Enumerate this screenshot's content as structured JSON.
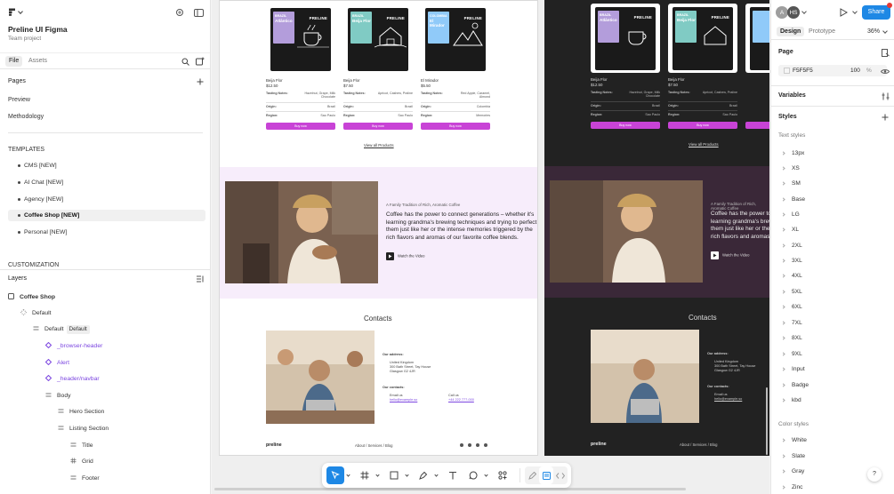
{
  "left_panel": {
    "project_name": "Preline UI Figma",
    "team": "Team project",
    "tabs": {
      "file": "File",
      "assets": "Assets"
    },
    "pages_title": "Pages",
    "pages": [
      "Preview",
      "Methodology"
    ],
    "templates_title": "TEMPLATES",
    "templates": [
      "CMS [NEW]",
      "AI Chat [NEW]",
      "Agency [NEW]",
      "Coffee Shop [NEW]",
      "Personal [NEW]"
    ],
    "customization_title": "CUSTOMIZATION",
    "layers_title": "Layers",
    "layers": {
      "root": "Coffee Shop",
      "default_frame": "Default",
      "default_variant": "Default",
      "default_tag": "Default",
      "browser_header": "_browser-header",
      "alert": "Alert",
      "header_navbar": "_header/navbar",
      "body": "Body",
      "hero": "Hero Section",
      "listing": "Listing Section",
      "title": "Title",
      "grid": "Grid",
      "footer": "Footer"
    }
  },
  "canvas": {
    "products": [
      {
        "brand": "PRELINE",
        "label_small": "BRAZIL",
        "label_title": "Atlântico",
        "label_color": "#b39ddb",
        "name": "Beija Flor",
        "price": "$12.50",
        "notes_key": "Tasting Notes:",
        "notes": "Hazelnut, Grape, Milk Chocolate",
        "origin_key": "Origin:",
        "origin": "Brazil",
        "region_key": "Region:",
        "region": "Sao Paulo",
        "buy": "Buy now"
      },
      {
        "brand": "PRELINE",
        "label_small": "BRAZIL",
        "label_title": "Beija Flor",
        "label_color": "#80cbc4",
        "name": "Beija Flor",
        "price": "$7.50",
        "notes_key": "Tasting Notes:",
        "notes": "Apricot, Cashew, Praline",
        "origin_key": "Origin:",
        "origin": "Brazil",
        "region_key": "Region:",
        "region": "Sao Paulo",
        "buy": "Buy now"
      },
      {
        "brand": "PRELINE",
        "label_small": "COLOMBIA",
        "label_title": "El Mirador",
        "label_color": "#90caf9",
        "name": "El Mirador",
        "price": "$5.50",
        "notes_key": "Tasting Notes:",
        "notes": "Red Apple, Caramel, Almond",
        "origin_key": "Origin:",
        "origin": "Colombia",
        "region_key": "Region:",
        "region": "Memories",
        "buy": "Buy now"
      }
    ],
    "view_all": "View all Products",
    "story_kicker": "A Family Tradition of Rich, Aromatic Coffee",
    "story_text": "Coffee has the power to connect generations – whether it's learning grandma's brewing techniques and trying to perfect them just like her or the intense memories triggered by the rich flavors and aromas of our favorite coffee blends.",
    "watch_video": "Watch the Video",
    "contacts_title": "Contacts",
    "address_title": "Our address:",
    "address_lines": [
      "United Kingdom",
      "300 Bath Street, Tay House",
      "Glasgow G2 4JR"
    ],
    "contacts_sub": "Our contacts:",
    "email_label": "Email us",
    "email": "hello@example.so",
    "call_label": "Call us",
    "phone": "+44 222 777-000",
    "footer_logo": "preline",
    "footer_nav": [
      "About",
      "Services",
      "Blog"
    ],
    "footer_sep": "/"
  },
  "right_panel": {
    "avatar_a": "A",
    "avatar_hs": "HS",
    "share": "Share",
    "tabs": {
      "design": "Design",
      "prototype": "Prototype"
    },
    "zoom": "36%",
    "page_title": "Page",
    "fill_hex": "F5F5F5",
    "fill_opacity": "100",
    "fill_unit": "%",
    "variables_title": "Variables",
    "styles_title": "Styles",
    "text_styles_title": "Text styles",
    "text_styles": [
      "13px",
      "XS",
      "SM",
      "Base",
      "LG",
      "XL",
      "2XL",
      "3XL",
      "4XL",
      "5XL",
      "6XL",
      "7XL",
      "8XL",
      "9XL",
      "Input",
      "Badge",
      "kbd"
    ],
    "color_styles_title": "Color styles",
    "color_styles": [
      "White",
      "Slate",
      "Gray",
      "Zinc"
    ],
    "help": "?"
  },
  "colors": {
    "accent": "#1e88e5",
    "buy": "#c843d6",
    "component": "#7b45e0"
  }
}
